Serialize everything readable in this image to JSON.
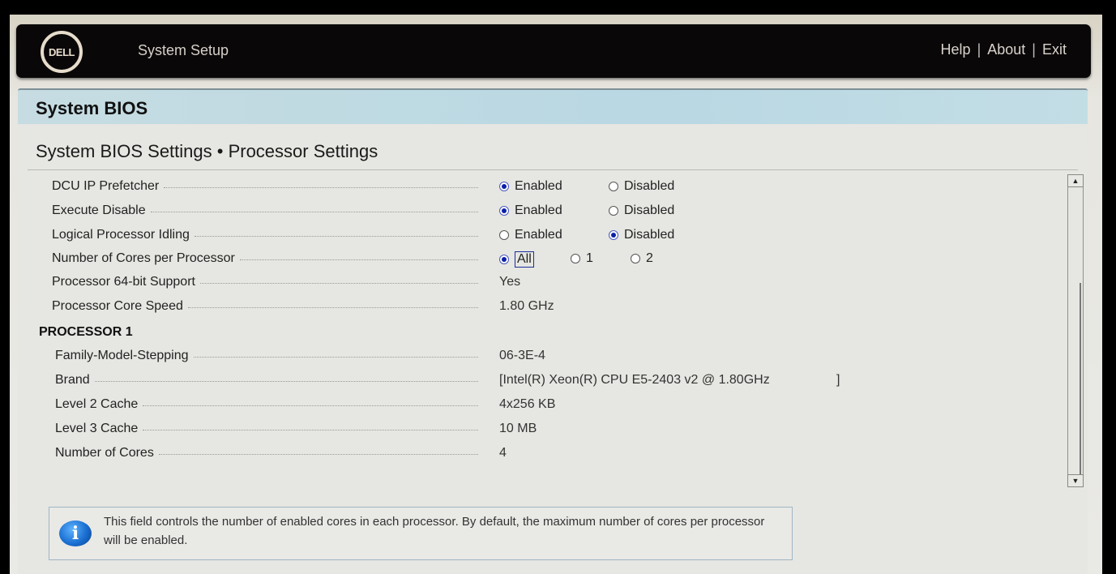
{
  "header": {
    "logo_text": "DELL",
    "app_title": "System Setup",
    "links": [
      "Help",
      "About",
      "Exit"
    ],
    "separator": "|"
  },
  "section": {
    "title": "System BIOS"
  },
  "breadcrumb": {
    "text": "System BIOS Settings • Processor Settings"
  },
  "settings": [
    {
      "label": "DCU IP Prefetcher",
      "type": "radio",
      "options": [
        "Enabled",
        "Disabled"
      ],
      "selected": "Enabled"
    },
    {
      "label": "Execute Disable",
      "type": "radio",
      "options": [
        "Enabled",
        "Disabled"
      ],
      "selected": "Enabled"
    },
    {
      "label": "Logical Processor Idling",
      "type": "radio",
      "options": [
        "Enabled",
        "Disabled"
      ],
      "selected": "Disabled"
    },
    {
      "label": "Number of Cores per Processor",
      "type": "radio",
      "options": [
        "All",
        "1",
        "2"
      ],
      "selected": "All",
      "focused": true
    },
    {
      "label": "Processor 64-bit Support",
      "type": "text",
      "value": "Yes"
    },
    {
      "label": "Processor Core Speed",
      "type": "text",
      "value": "1.80 GHz"
    }
  ],
  "processor_group": {
    "heading": "PROCESSOR 1",
    "fields": [
      {
        "label": "Family-Model-Stepping",
        "value": "06-3E-4"
      },
      {
        "label": "Brand",
        "value": "[Intel(R) Xeon(R) CPU E5-2403 v2 @ 1.80GHz",
        "value_suffix": "]"
      },
      {
        "label": "Level 2 Cache",
        "value": "4x256 KB"
      },
      {
        "label": "Level 3 Cache",
        "value": "10 MB"
      },
      {
        "label": "Number of Cores",
        "value": "4"
      }
    ]
  },
  "scrollbar": {
    "up_icon": "▲",
    "down_icon": "▼"
  },
  "help": {
    "icon": "i",
    "text": "This field controls the number of enabled cores in each processor. By default, the maximum number of cores per processor will be enabled."
  }
}
